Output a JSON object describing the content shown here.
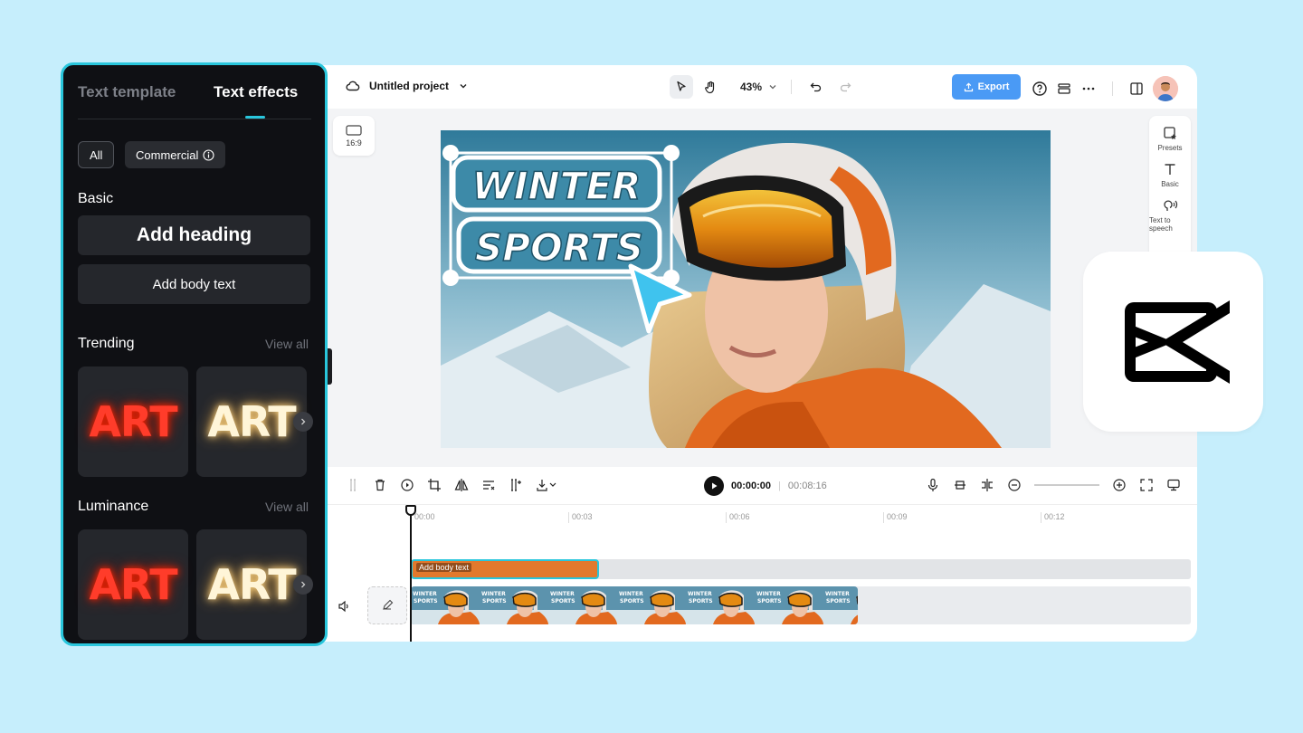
{
  "topbar": {
    "project_name": "Untitled project",
    "zoom": "43%",
    "export_label": "Export"
  },
  "canvas": {
    "aspect_ratio": "16:9",
    "title_line1": "WINTER",
    "title_line2": "SPORTS"
  },
  "right_panel": {
    "items": [
      {
        "label": "Presets",
        "icon": "presets-icon"
      },
      {
        "label": "Basic",
        "icon": "text-icon"
      },
      {
        "label": "Text to speech",
        "icon": "speech-icon"
      }
    ]
  },
  "timeline": {
    "current_time": "00:00:00",
    "total_time": "00:08:16",
    "ruler": [
      "00:00",
      "00:03",
      "00:06",
      "00:09",
      "00:12"
    ],
    "text_clip_label": "Add body text",
    "thumb_line1": "WINTER",
    "thumb_line2": "SPORTS"
  },
  "left_panel": {
    "tabs": [
      {
        "label": "Text template",
        "active": false
      },
      {
        "label": "Text effects",
        "active": true
      }
    ],
    "filters": [
      "All",
      "Commercial"
    ],
    "basic_title": "Basic",
    "add_heading": "Add heading",
    "add_body": "Add body text",
    "trending_title": "Trending",
    "luminance_title": "Luminance",
    "view_all": "View all",
    "card_text": "ART"
  },
  "colors": {
    "accent": "#29c6dc",
    "export": "#4a9af5",
    "panel_bg": "#0f1014",
    "background": "#c6eefc"
  }
}
